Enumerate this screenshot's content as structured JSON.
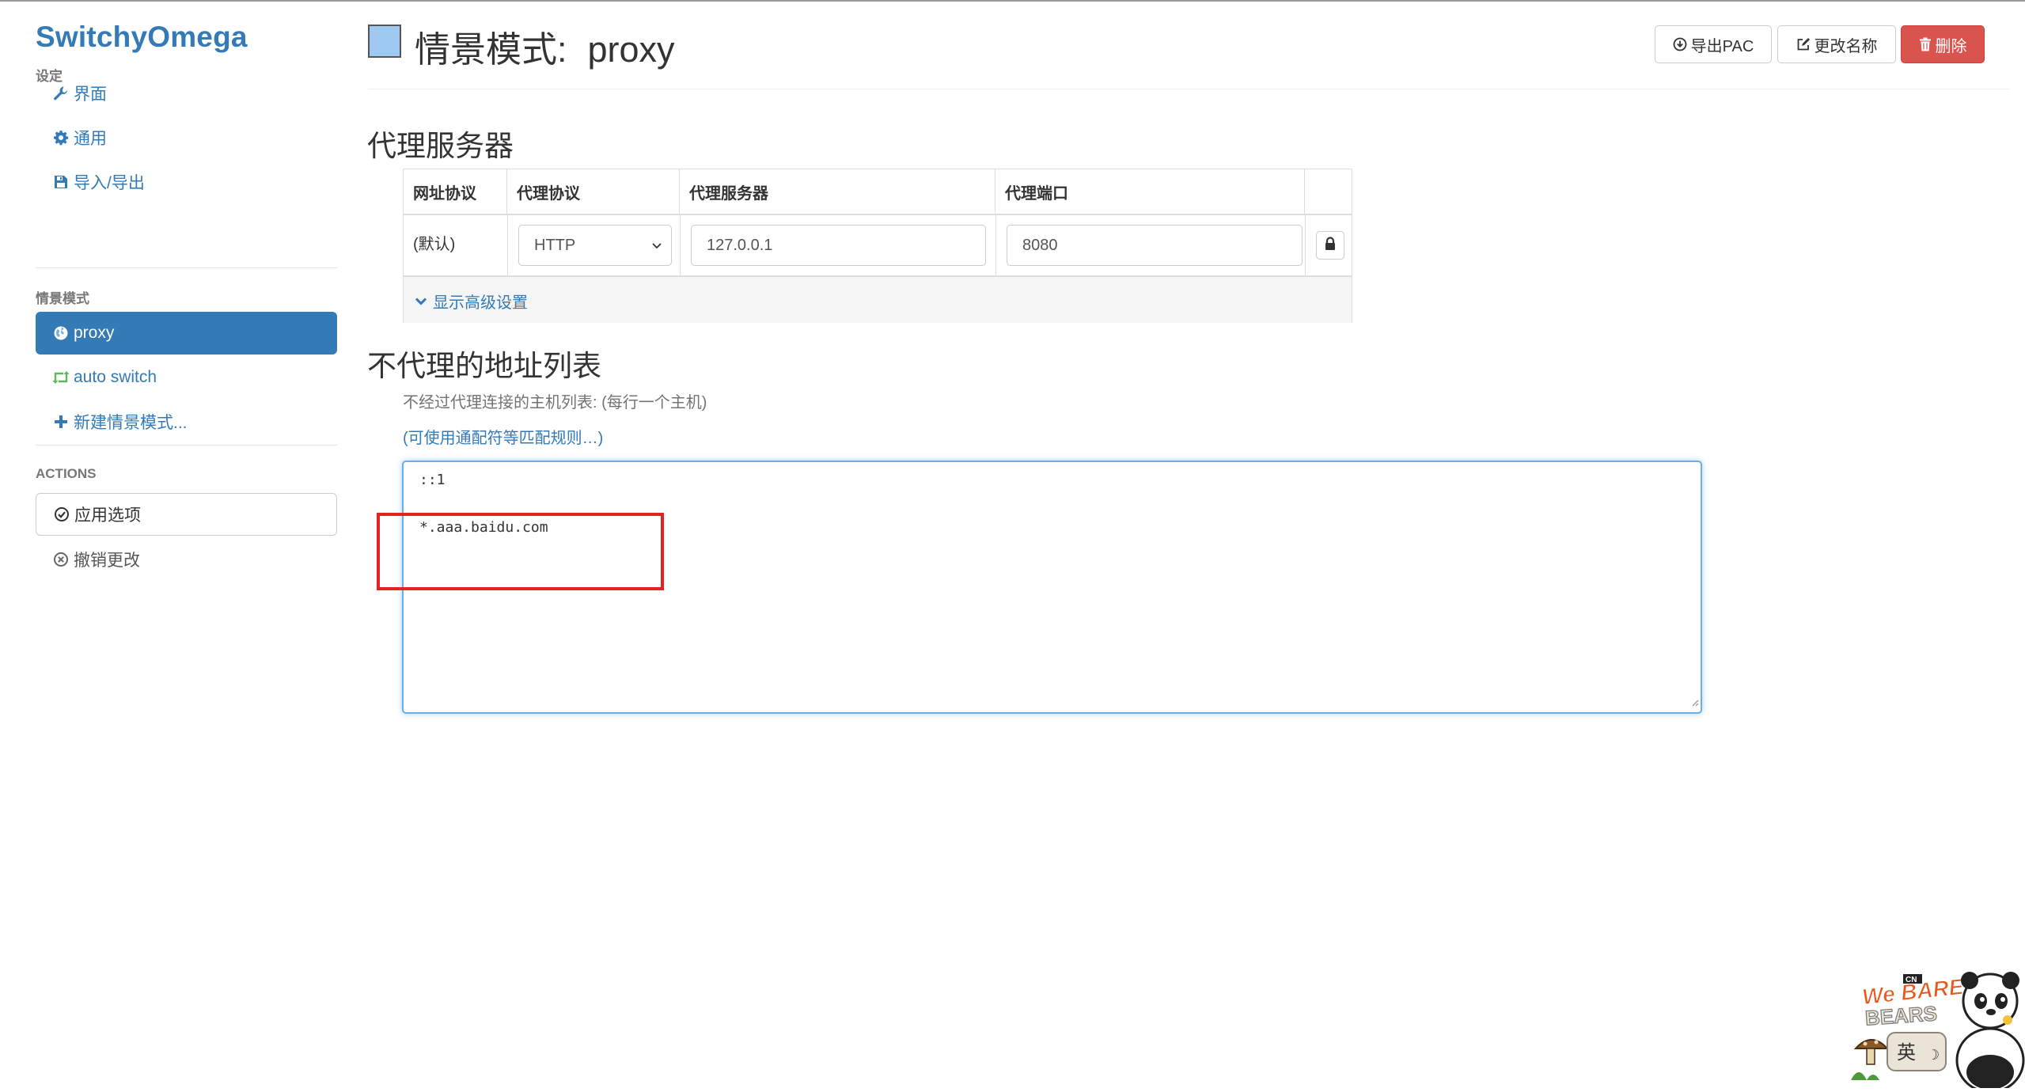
{
  "app": {
    "brand": "SwitchyOmega"
  },
  "sidebar": {
    "settings_header": "设定",
    "settings_items": [
      {
        "label": "界面",
        "icon": "wrench-icon"
      },
      {
        "label": "通用",
        "icon": "gear-icon"
      },
      {
        "label": "导入/导出",
        "icon": "save-icon"
      }
    ],
    "profiles_header": "情景模式",
    "profiles": [
      {
        "label": "proxy",
        "icon": "globe-icon",
        "active": true
      },
      {
        "label": "auto switch",
        "icon": "retweet-icon",
        "active": false
      }
    ],
    "new_profile": "新建情景模式...",
    "actions_header": "ACTIONS",
    "apply_label": "应用选项",
    "discard_label": "撤销更改"
  },
  "header": {
    "title_prefix": "情景模式:",
    "profile_name": "proxy",
    "profile_color": "#9ec9f0",
    "export_pac": "导出PAC",
    "rename": "更改名称",
    "delete": "删除"
  },
  "proxy_servers": {
    "title": "代理服务器",
    "columns": [
      "网址协议",
      "代理协议",
      "代理服务器",
      "代理端口"
    ],
    "rows": [
      {
        "scheme": "(默认)",
        "protocol": "HTTP",
        "server": "127.0.0.1",
        "port": "8080"
      }
    ],
    "show_advanced": "显示高级设置"
  },
  "bypass": {
    "title": "不代理的地址列表",
    "help": "不经过代理连接的主机列表: (每行一个主机)",
    "rules_link": "(可使用通配符等匹配规则…)",
    "lines": [
      "::1",
      "*.aaa.baidu.com"
    ]
  },
  "widget": {
    "brand": "We BARE BEARS",
    "badge": "CN",
    "ime_label": "英"
  },
  "colors": {
    "accent": "#337ab7",
    "danger": "#d9534f",
    "highlight": "#e52222",
    "auto_switch": "#5cb85c"
  }
}
